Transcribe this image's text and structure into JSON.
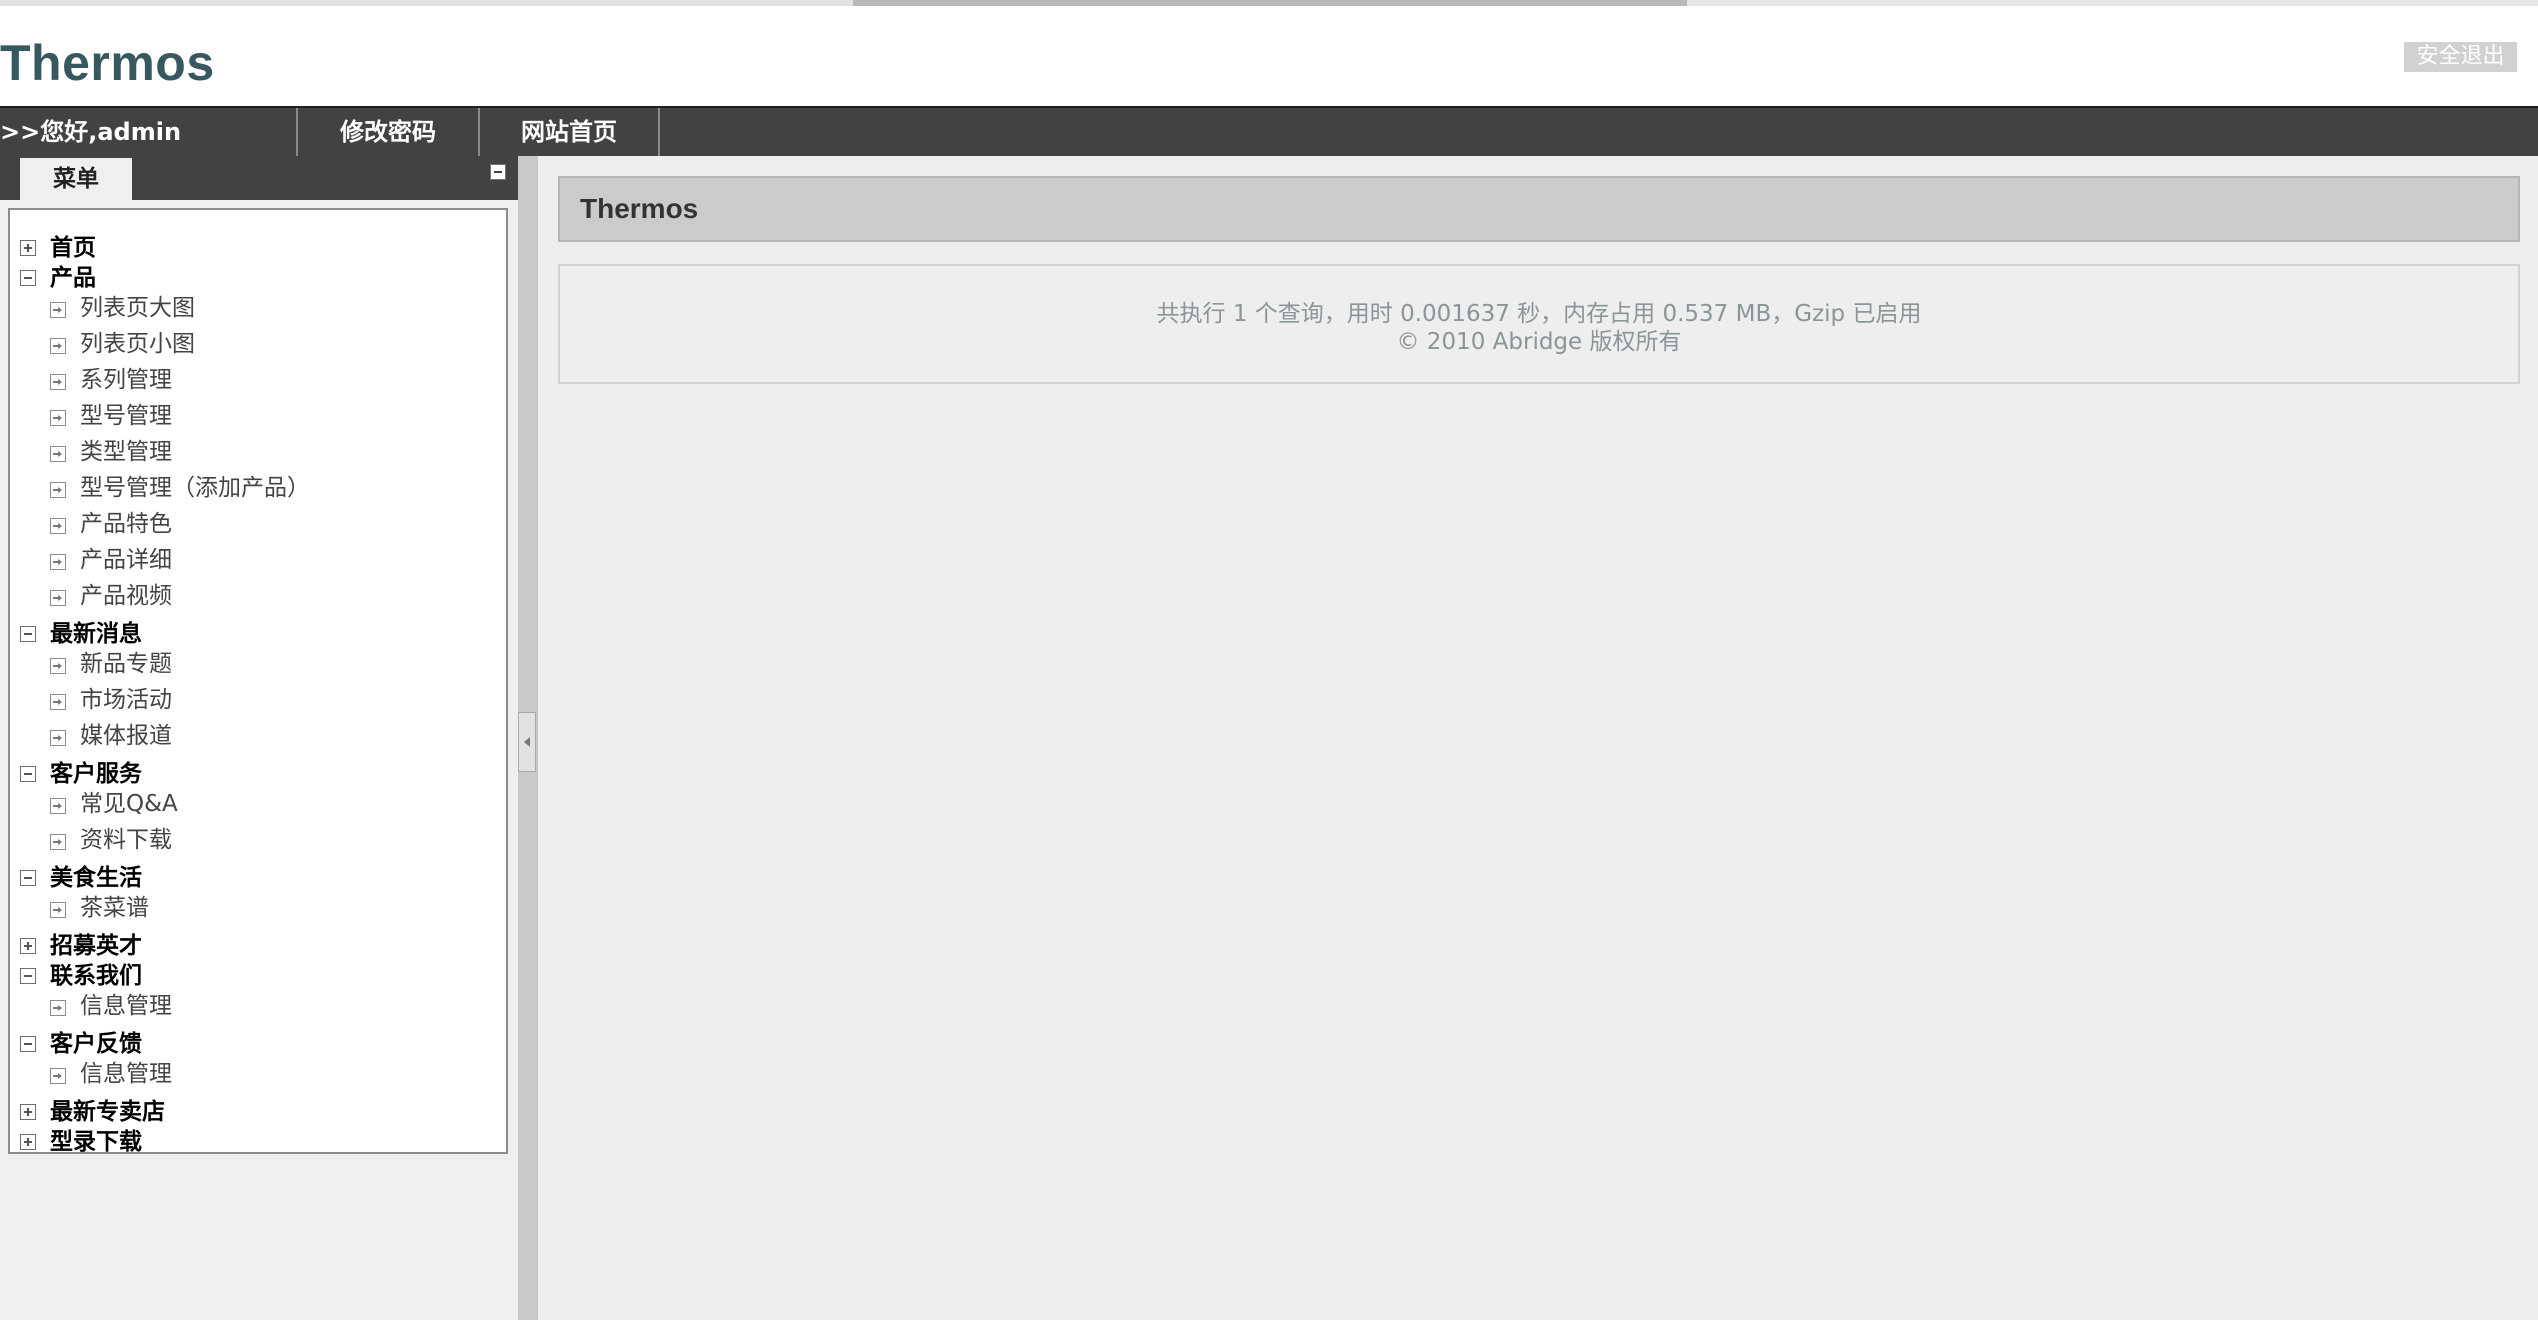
{
  "header": {
    "logo": "Thermos",
    "logout_label": "安全退出"
  },
  "navbar": {
    "greeting": ">>您好,admin",
    "change_password": "修改密码",
    "site_home": "网站首页"
  },
  "sidebar": {
    "tab_label": "菜单",
    "tree": [
      {
        "label": "首页",
        "expanded": false,
        "children": []
      },
      {
        "label": "产品",
        "expanded": true,
        "children": [
          "列表页大图",
          "列表页小图",
          "系列管理",
          "型号管理",
          "类型管理",
          "型号管理（添加产品）",
          "产品特色",
          "产品详细",
          "产品视频"
        ]
      },
      {
        "label": "最新消息",
        "expanded": true,
        "children": [
          "新品专题",
          "市场活动",
          "媒体报道"
        ]
      },
      {
        "label": "客户服务",
        "expanded": true,
        "children": [
          "常见Q&A",
          "资料下载"
        ]
      },
      {
        "label": "美食生活",
        "expanded": true,
        "children": [
          "茶菜谱"
        ]
      },
      {
        "label": "招募英才",
        "expanded": false,
        "children": []
      },
      {
        "label": "联系我们",
        "expanded": true,
        "children": [
          "信息管理"
        ]
      },
      {
        "label": "客户反馈",
        "expanded": true,
        "children": [
          "信息管理"
        ]
      },
      {
        "label": "最新专卖店",
        "expanded": false,
        "children": []
      },
      {
        "label": "型录下载",
        "expanded": false,
        "children": []
      }
    ]
  },
  "main": {
    "title": "Thermos",
    "footer_stats": "共执行 1 个查询，用时 0.001637 秒，内存占用 0.537 MB，Gzip 已启用",
    "copyright": "© 2010 Abridge 版权所有"
  }
}
